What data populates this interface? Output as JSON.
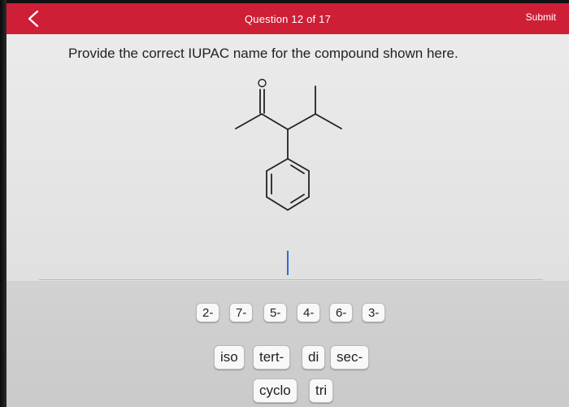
{
  "header": {
    "title": "Question 12 of 17",
    "submit_label": "Submit",
    "back_icon": "chevron-left-icon",
    "background": "#cf1f37"
  },
  "question": {
    "prompt": "Provide the correct IUPAC name for the compound shown here."
  },
  "molecule": {
    "atom_labels": [
      "O"
    ]
  },
  "tiles": {
    "locants": [
      "2-",
      "7-",
      "5-",
      "4-",
      "6-",
      "3-"
    ],
    "prefixes": [
      "iso",
      "tert-",
      "di",
      "sec-"
    ],
    "extras": [
      "cyclo",
      "tri"
    ]
  }
}
